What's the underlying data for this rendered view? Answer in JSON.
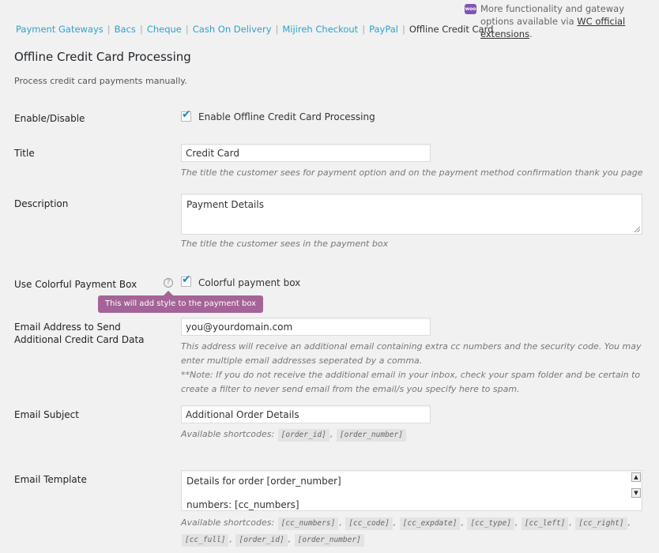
{
  "subnav": {
    "items": [
      {
        "label": "Payment Gateways"
      },
      {
        "label": "Bacs"
      },
      {
        "label": "Cheque"
      },
      {
        "label": "Cash On Delivery"
      },
      {
        "label": "Mijireh Checkout"
      },
      {
        "label": "PayPal"
      },
      {
        "label": "Offline Credit Card"
      }
    ],
    "separator": "|"
  },
  "notice": {
    "badge": "woo",
    "text": "More functionality and gateway options available via",
    "link": "WC official extensions",
    "end": "."
  },
  "page": {
    "title": "Offline Credit Card Processing",
    "description": "Process credit card payments manually."
  },
  "fields": {
    "enable": {
      "label": "Enable/Disable",
      "checkbox_label": "Enable Offline Credit Card Processing",
      "checked": true
    },
    "title": {
      "label": "Title",
      "value": "Credit Card",
      "help": "The title the customer sees for payment option and on the payment method confirmation thank you page"
    },
    "description": {
      "label": "Description",
      "value": "Payment Details",
      "help": "The title the customer sees in the payment box"
    },
    "colorful": {
      "label": "Use Colorful Payment Box",
      "help_icon": "?",
      "checkbox_label": "Colorful payment box",
      "checked": true,
      "tooltip": "This will add style to the payment box"
    },
    "email": {
      "label_line1": "Email Address to Send",
      "label_line2": "Additional Credit Card Data",
      "value": "you@yourdomain.com",
      "help1": "This address will receive an additional email containing extra cc numbers and the security code. You may enter multiple email addresses seperated by a comma.",
      "help2": "**Note: If you do not receive the additional email in your inbox, check your spam folder and be certain to create a filter to never send email from the email/s you specify here to spam."
    },
    "subject": {
      "label": "Email Subject",
      "value": "Additional Order Details",
      "shortcodes_label": "Available shortcodes:",
      "shortcodes": [
        "[order_id]",
        "[order_number]"
      ]
    },
    "template": {
      "label": "Email Template",
      "line1": "Details for order [order_number]",
      "line2": "numbers: [cc_numbers]",
      "shortcodes_label": "Available shortcodes:",
      "shortcodes": [
        "[cc_numbers]",
        "[cc_code]",
        "[cc_expdate]",
        "[cc_type]",
        "[cc_left]",
        "[cc_right]",
        "[cc_full]",
        "[order_id]",
        "[order_number]"
      ]
    }
  },
  "colors": {
    "link": "#2ea2cc",
    "tooltip": "#a46497",
    "checkbox": "#1e8cbe"
  }
}
